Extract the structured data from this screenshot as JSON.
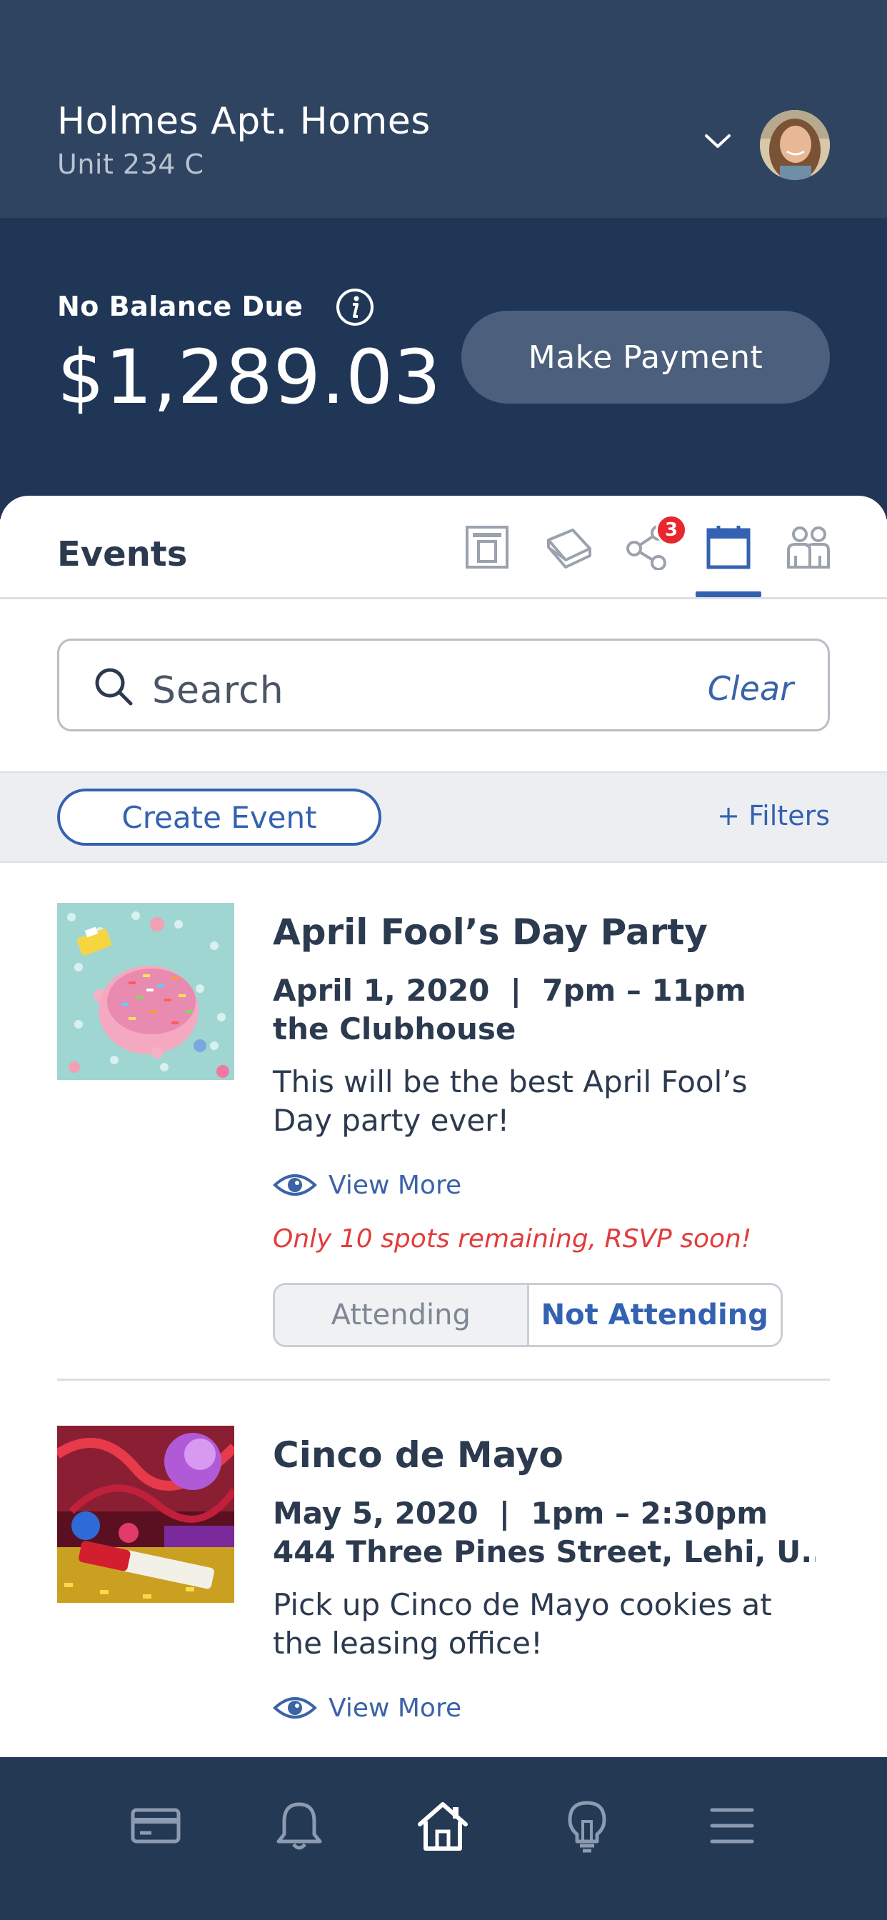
{
  "header": {
    "property_name": "Holmes Apt. Homes",
    "unit": "Unit 234 C"
  },
  "balance": {
    "label": "No Balance Due",
    "amount": "$1,289.03",
    "pay_button": "Make Payment"
  },
  "events_panel": {
    "title": "Events",
    "tabs": [
      {
        "icon": "newsletter-icon"
      },
      {
        "icon": "documents-icon"
      },
      {
        "icon": "share-icon",
        "badge": "3"
      },
      {
        "icon": "calendar-icon",
        "active": true
      },
      {
        "icon": "community-icon"
      }
    ],
    "search": {
      "placeholder": "Search",
      "clear_label": "Clear"
    },
    "create_button": "Create Event",
    "filters_label": "+ Filters"
  },
  "events": [
    {
      "title": "April Fool’s Day Party",
      "date_time": "April 1, 2020  |  7pm – 11pm",
      "location": "the Clubhouse",
      "description": "This will be the best April Fool’s Day party ever!",
      "view_more": "View More",
      "note": "Only 10 spots remaining, RSVP soon!",
      "rsvp": {
        "attending": "Attending",
        "not_attending": "Not Attending",
        "selected": "Not Attending"
      }
    },
    {
      "title": "Cinco de Mayo",
      "date_time": "May 5, 2020  |  1pm – 2:30pm",
      "location": "444 Three Pines Street, Lehi, U...",
      "description": "Pick up Cinco de Mayo cookies at the leasing office!",
      "view_more": "View More"
    }
  ],
  "bottom_nav": [
    {
      "icon": "payment-card-icon"
    },
    {
      "icon": "bell-icon"
    },
    {
      "icon": "home-icon",
      "active": true
    },
    {
      "icon": "lightbulb-icon"
    },
    {
      "icon": "menu-icon"
    }
  ],
  "colors": {
    "header_bg": "#2f4461",
    "balance_bg": "#1f3656",
    "accent": "#3462b2",
    "alert": "#e23c3c",
    "badge": "#e8262d"
  }
}
